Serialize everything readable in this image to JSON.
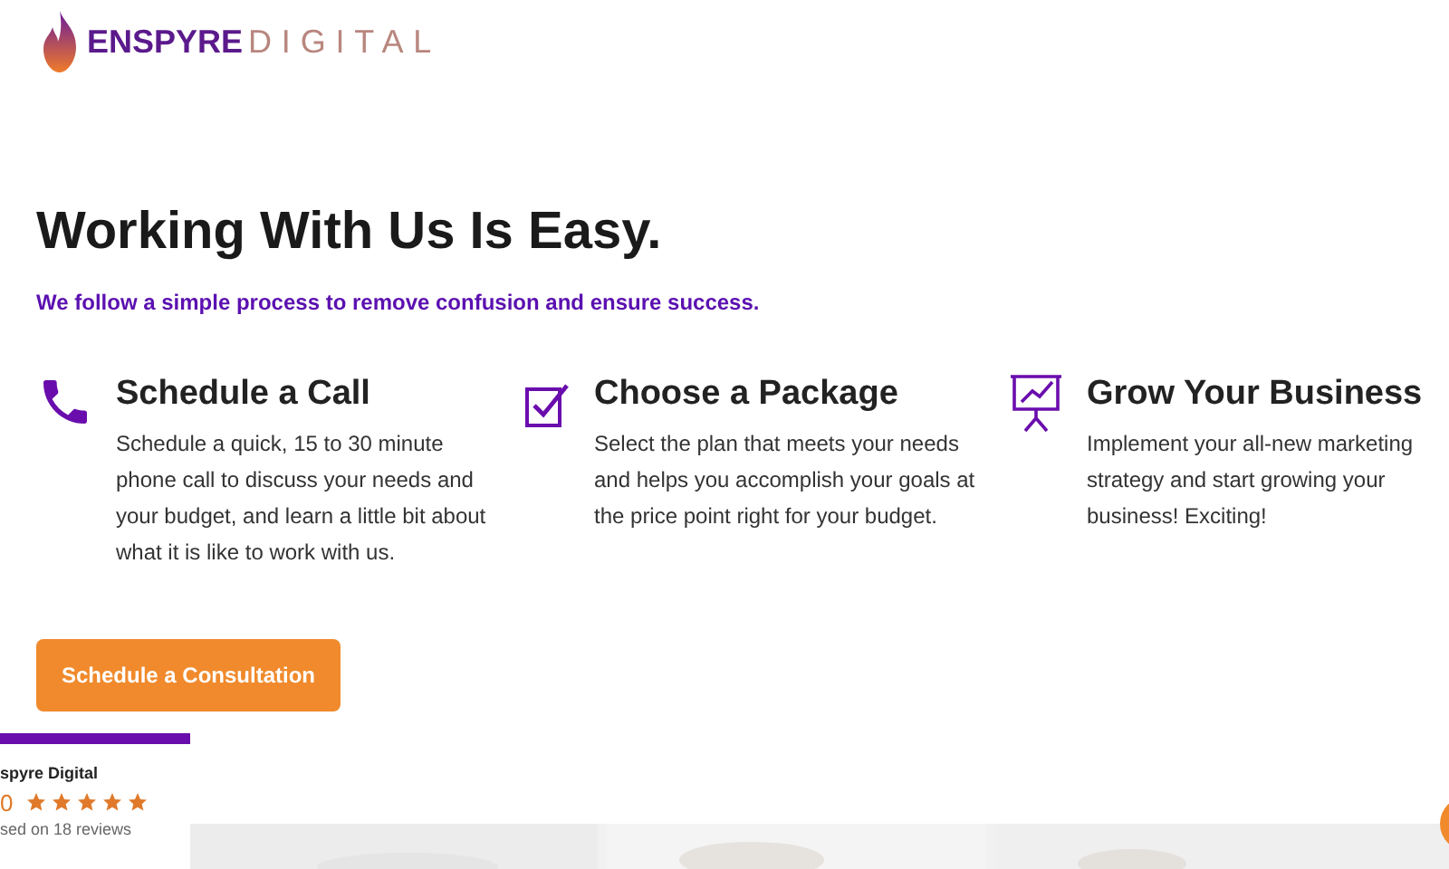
{
  "logo": {
    "brand": "ENSPYRE",
    "suffix": "DIGITAL"
  },
  "heading": "Working With Us Is Easy.",
  "subheading": "We follow a simple process to remove confusion and ensure success.",
  "steps": [
    {
      "kind": "phone",
      "title": "Schedule a Call",
      "text": "Schedule a quick, 15 to 30 minute phone call to discuss your needs and your budget, and learn a little bit about what it is like to work with us."
    },
    {
      "kind": "check",
      "title": "Choose a Package",
      "text": "Select the plan that meets your needs and helps you accomplish your goals at the price point right for your budget."
    },
    {
      "kind": "chart",
      "title": "Grow Your Business",
      "text": "Implement your all-new marketing strategy and start growing your business! Exciting!"
    }
  ],
  "cta": "Schedule a Consultation",
  "reviews": {
    "name": "spyre Digital",
    "rating": "0",
    "stars": 5,
    "summary": "sed on 18 reviews"
  }
}
